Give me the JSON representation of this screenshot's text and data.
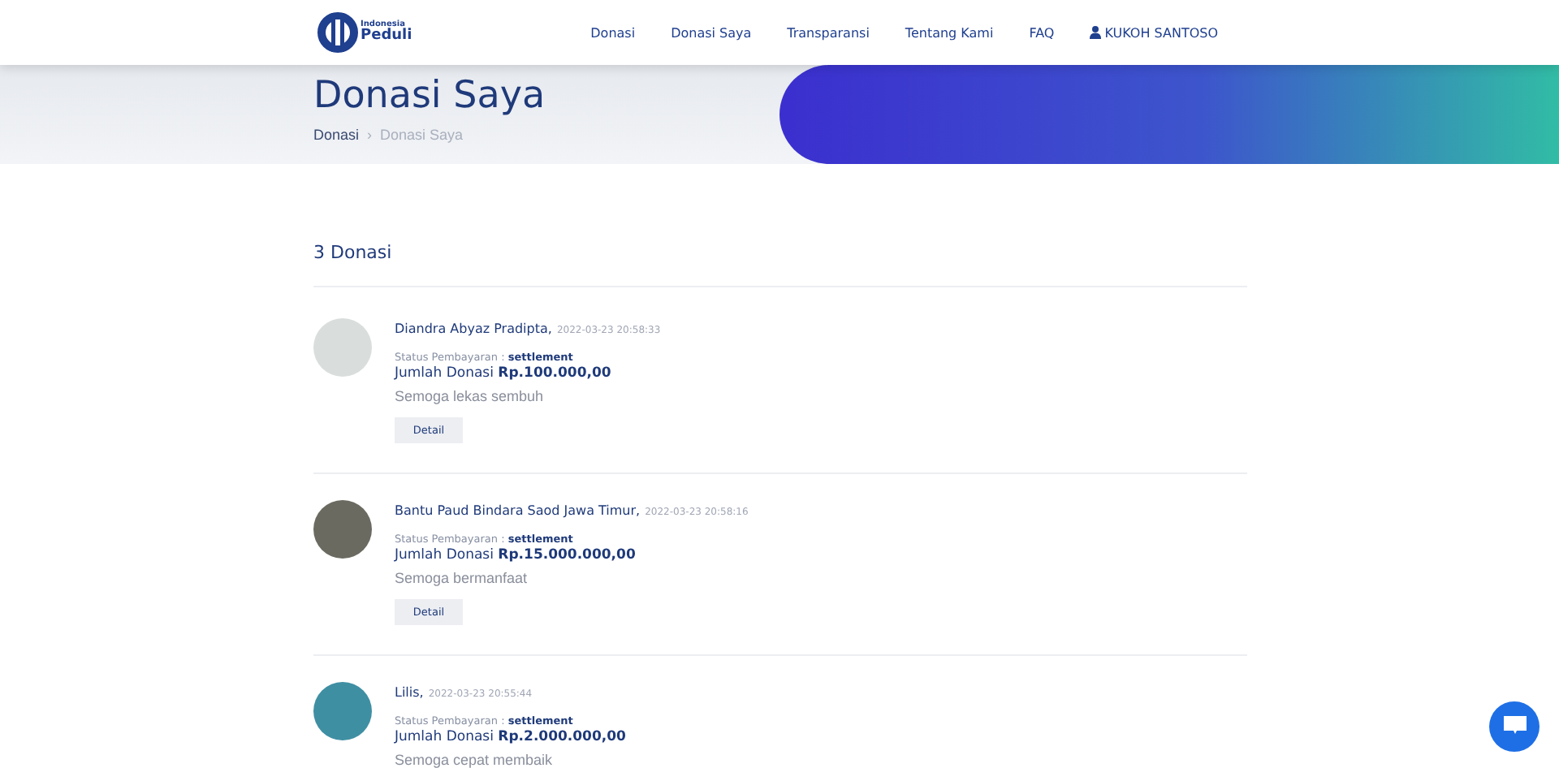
{
  "logo": {
    "line_1": "Indonesia",
    "line_2": "Peduli"
  },
  "nav": [
    {
      "label": "Donasi",
      "kind": "link"
    },
    {
      "label": "Donasi Saya",
      "kind": "link"
    },
    {
      "label": "Transparansi",
      "kind": "link"
    },
    {
      "label": "Tentang Kami",
      "kind": "link"
    },
    {
      "label": "FAQ",
      "kind": "link"
    },
    {
      "label": "KUKOH SANTOSO",
      "kind": "user"
    }
  ],
  "hero": {
    "title": "Donasi Saya",
    "breadcrumb": [
      {
        "label": "Donasi",
        "current": false
      },
      {
        "label": "Donasi Saya",
        "current": true
      }
    ],
    "separator": "›"
  },
  "count": "3 Donasi",
  "donations": [
    {
      "campaign": "Diandra Abyaz Pradipta,",
      "time": "2022-03-23 20:58:33",
      "status_label": "Status Pembayaran :",
      "status": "settlement",
      "amount_label": "Jumlah Donasi",
      "amount": "Rp.100.000,00",
      "message": "Semoga lekas sembuh",
      "button": "Detail"
    },
    {
      "campaign": "Bantu Paud Bindara Saod Jawa Timur,",
      "time": "2022-03-23 20:58:16",
      "status_label": "Status Pembayaran :",
      "status": "settlement",
      "amount_label": "Jumlah Donasi",
      "amount": "Rp.15.000.000,00",
      "message": "Semoga bermanfaat",
      "button": "Detail"
    },
    {
      "campaign": "Lilis,",
      "time": "2022-03-23 20:55:44",
      "status_label": "Status Pembayaran :",
      "status": "settlement",
      "amount_label": "Jumlah Donasi",
      "amount": "Rp.2.000.000,00",
      "message": "Semoga cepat membaik"
    }
  ]
}
